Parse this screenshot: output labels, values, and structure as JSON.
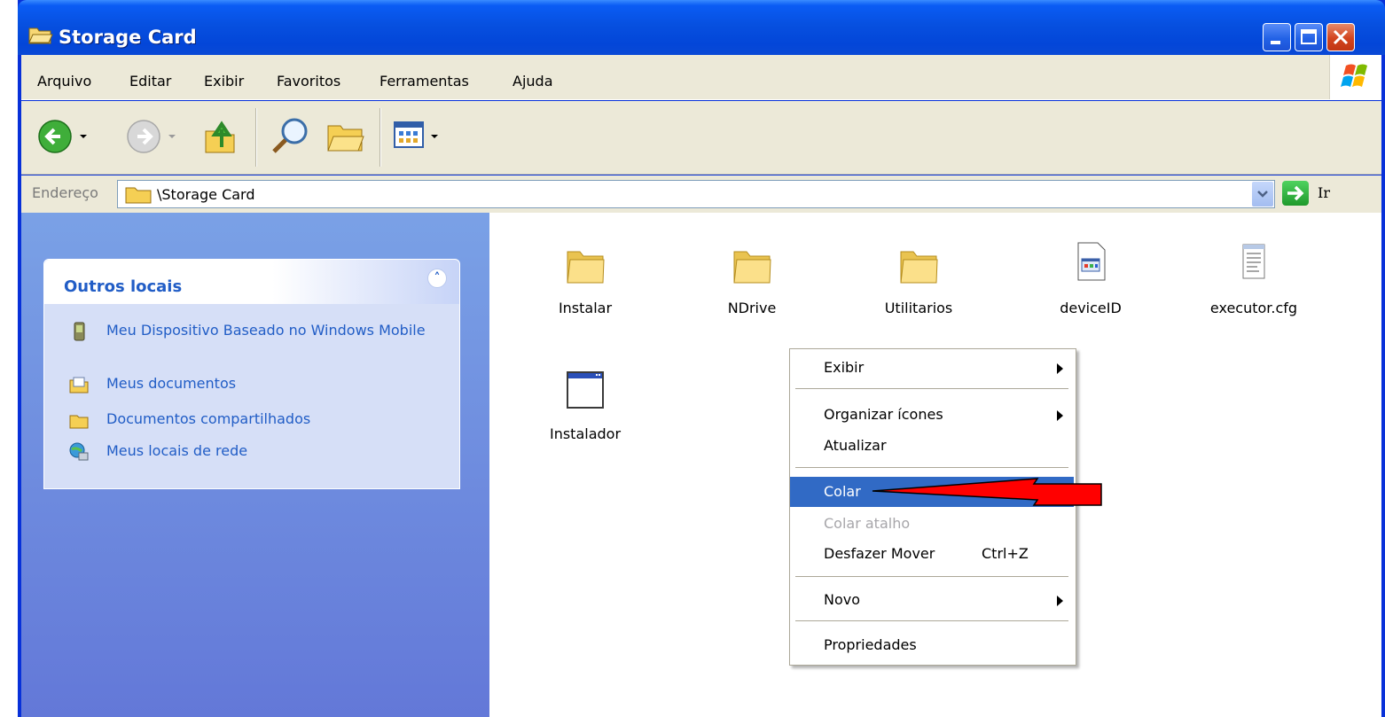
{
  "window": {
    "title": "Storage Card",
    "title_icon": "folder-open-icon",
    "buttons": [
      "minimize-icon",
      "maximize-icon",
      "close-icon"
    ]
  },
  "menu": {
    "items": [
      "Arquivo",
      "Editar",
      "Exibir",
      "Favoritos",
      "Ferramentas",
      "Ajuda"
    ]
  },
  "toolbar": {
    "icons": [
      "back-icon",
      "forward-icon",
      "up-folder-icon",
      "search-icon",
      "folders-icon",
      "views-icon"
    ]
  },
  "address": {
    "label": "Endereço",
    "path": "\\Storage Card",
    "go_label": "Ir"
  },
  "sidebar": {
    "panel_title": "Outros locais",
    "items": [
      {
        "label": "Meu Dispositivo Baseado no Windows Mobile",
        "icon": "mobile-device-icon"
      },
      {
        "label": "Meus documentos",
        "icon": "my-documents-icon"
      },
      {
        "label": "Documentos compartilhados",
        "icon": "shared-documents-icon"
      },
      {
        "label": "Meus locais de rede",
        "icon": "network-places-icon"
      }
    ]
  },
  "files": [
    {
      "name": "Instalar",
      "icon": "folder-icon"
    },
    {
      "name": "NDrive",
      "icon": "folder-icon"
    },
    {
      "name": "Utilitarios",
      "icon": "folder-icon"
    },
    {
      "name": "deviceID",
      "icon": "image-file-icon"
    },
    {
      "name": "executor.cfg",
      "icon": "text-file-icon"
    },
    {
      "name": "Instalador",
      "icon": "application-icon"
    }
  ],
  "context_menu": {
    "items": [
      {
        "label": "Exibir",
        "submenu": true
      },
      {
        "label": "Organizar ícones",
        "submenu": true
      },
      {
        "label": "Atualizar"
      },
      {
        "label": "Colar",
        "highlighted": true
      },
      {
        "label": "Colar atalho",
        "disabled": true
      },
      {
        "label": "Desfazer Mover",
        "shortcut": "Ctrl+Z"
      },
      {
        "label": "Novo",
        "submenu": true
      },
      {
        "label": "Propriedades"
      }
    ]
  },
  "annotation": {
    "icon": "red-arrow-icon",
    "color": "#ff0000"
  },
  "colors": {
    "selection": "#316ac5",
    "sidebar_link": "#215dc6",
    "titlebar": "#0a5cf4"
  }
}
